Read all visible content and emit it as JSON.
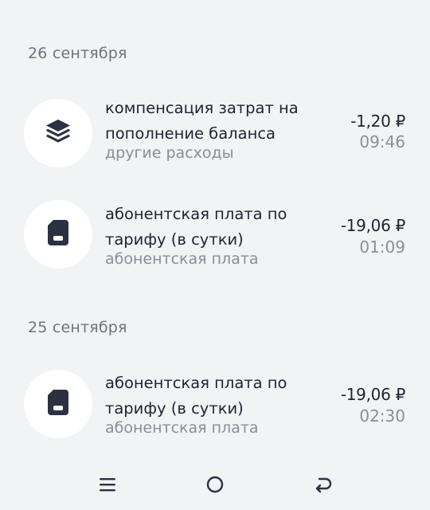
{
  "groups": [
    {
      "date": "26 сентября",
      "items": [
        {
          "icon": "layers-icon",
          "title_line1": "компенсация затрат на",
          "title_line2": "пополнение баланса",
          "category": "другие расходы",
          "amount": "-1,20 ₽",
          "time": "09:46"
        },
        {
          "icon": "sim-card-icon",
          "title_line1": "абонентская плата по",
          "title_line2": "тарифу (в сутки)",
          "category": "абонентская плата",
          "amount": "-19,06 ₽",
          "time": "01:09"
        }
      ]
    },
    {
      "date": "25 сентября",
      "items": [
        {
          "icon": "sim-card-icon",
          "title_line1": "абонентская плата по",
          "title_line2": "тарифу (в сутки)",
          "category": "абонентская плата",
          "amount": "-19,06 ₽",
          "time": "02:30"
        }
      ]
    }
  ],
  "navbar": {
    "buttons": [
      "menu-icon",
      "home-icon",
      "back-icon"
    ]
  },
  "colors": {
    "background": "#f2f3f5",
    "text_primary": "#1f2430",
    "text_secondary": "#8a8e96",
    "icon": "#2b3140"
  }
}
